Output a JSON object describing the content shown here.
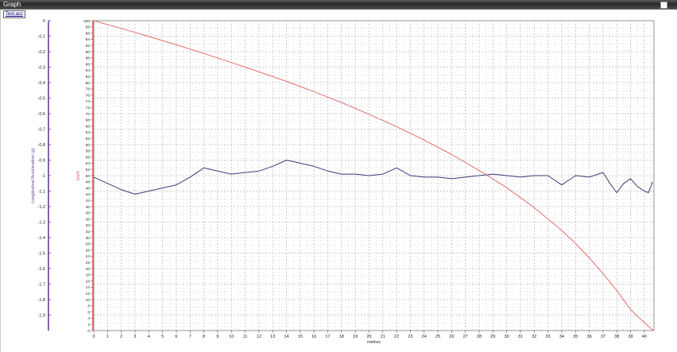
{
  "window": {
    "title": "Graph",
    "tab_label": "Test.acc"
  },
  "colors": {
    "speed_series": "#e46e6e",
    "accel_series": "#3a3a7a",
    "left_axis": "#6a3f8f",
    "red_axis": "#e05555",
    "grid": "#9a9a9a"
  },
  "chart_data": {
    "type": "line",
    "xlabel": "metres",
    "x_ticks": [
      0,
      1,
      2,
      3,
      4,
      5,
      6,
      7,
      8,
      9,
      10,
      11,
      12,
      13,
      14,
      15,
      16,
      17,
      18,
      19,
      20,
      21,
      22,
      23,
      24,
      25,
      26,
      27,
      28,
      29,
      30,
      31,
      32,
      33,
      34,
      35,
      36,
      37,
      38,
      39,
      40
    ],
    "xlim": [
      0,
      40.7
    ],
    "left_axis": {
      "label": "Longitudinal Acceleration (g)",
      "ylim": [
        -2.0,
        0
      ],
      "tick_labels": [
        "0",
        "-0.1",
        "-0.2",
        "-0.3",
        "-0.4",
        "-0.5",
        "-0.6",
        "-0.7",
        "-0.8",
        "-0.9",
        "-1",
        "-1.1",
        "-1.2",
        "-1.3",
        "-1.4",
        "-1.5",
        "-1.6",
        "-1.7",
        "-1.8",
        "-1.9"
      ]
    },
    "right_axis": {
      "label": "km/h",
      "ylim": [
        0,
        100
      ],
      "tick_labels": [
        "100",
        "98",
        "96",
        "94",
        "92",
        "90",
        "88",
        "86",
        "84",
        "82",
        "80",
        "78",
        "76",
        "74",
        "72",
        "70",
        "68",
        "66",
        "64",
        "62",
        "60",
        "58",
        "56",
        "54",
        "52",
        "50",
        "48",
        "46",
        "44",
        "42",
        "40",
        "38",
        "36",
        "34",
        "32",
        "30",
        "28",
        "26",
        "24",
        "22",
        "20",
        "18",
        "16",
        "14",
        "12",
        "10",
        "8",
        "6",
        "4",
        "2",
        "0"
      ]
    },
    "grid": true,
    "series": [
      {
        "axis": "left",
        "x": [
          0,
          1,
          2,
          3,
          4,
          5,
          6,
          7,
          8,
          9,
          10,
          11,
          12,
          13,
          14,
          15,
          16,
          17,
          18,
          19,
          20,
          21,
          22,
          23,
          24,
          25,
          26,
          27,
          28,
          29,
          30,
          31,
          32,
          33,
          34,
          35,
          36,
          37,
          37.5,
          38,
          38.5,
          39,
          39.5,
          40,
          40.3,
          40.6
        ],
        "y": [
          -1.01,
          -1.05,
          -1.09,
          -1.12,
          -1.1,
          -1.08,
          -1.06,
          -1.01,
          -0.95,
          -0.97,
          -0.99,
          -0.98,
          -0.97,
          -0.94,
          -0.9,
          -0.92,
          -0.94,
          -0.97,
          -0.99,
          -0.99,
          -1.0,
          -0.99,
          -0.95,
          -1.0,
          -1.01,
          -1.01,
          -1.02,
          -1.01,
          -1.0,
          -0.99,
          -1.0,
          -1.01,
          -1.0,
          -1.0,
          -1.06,
          -1.0,
          -1.01,
          -0.98,
          -1.05,
          -1.11,
          -1.05,
          -1.02,
          -1.07,
          -1.1,
          -1.11,
          -1.04
        ]
      },
      {
        "axis": "right",
        "x": [
          0,
          2,
          4,
          6,
          8,
          10,
          12,
          14,
          16,
          18,
          20,
          22,
          24,
          26,
          28,
          30,
          32,
          34,
          35,
          36,
          37,
          38,
          39,
          39.5,
          40,
          40.3,
          40.5,
          40.7
        ],
        "y": [
          100,
          97.5,
          94.9,
          92.2,
          89.4,
          86.5,
          83.5,
          80.4,
          77.1,
          73.6,
          69.8,
          65.8,
          61.5,
          56.8,
          51.7,
          46.1,
          39.7,
          32.3,
          28.1,
          23.5,
          18.4,
          12.9,
          6.8,
          4.6,
          2.6,
          1.4,
          0.6,
          0
        ]
      }
    ]
  }
}
